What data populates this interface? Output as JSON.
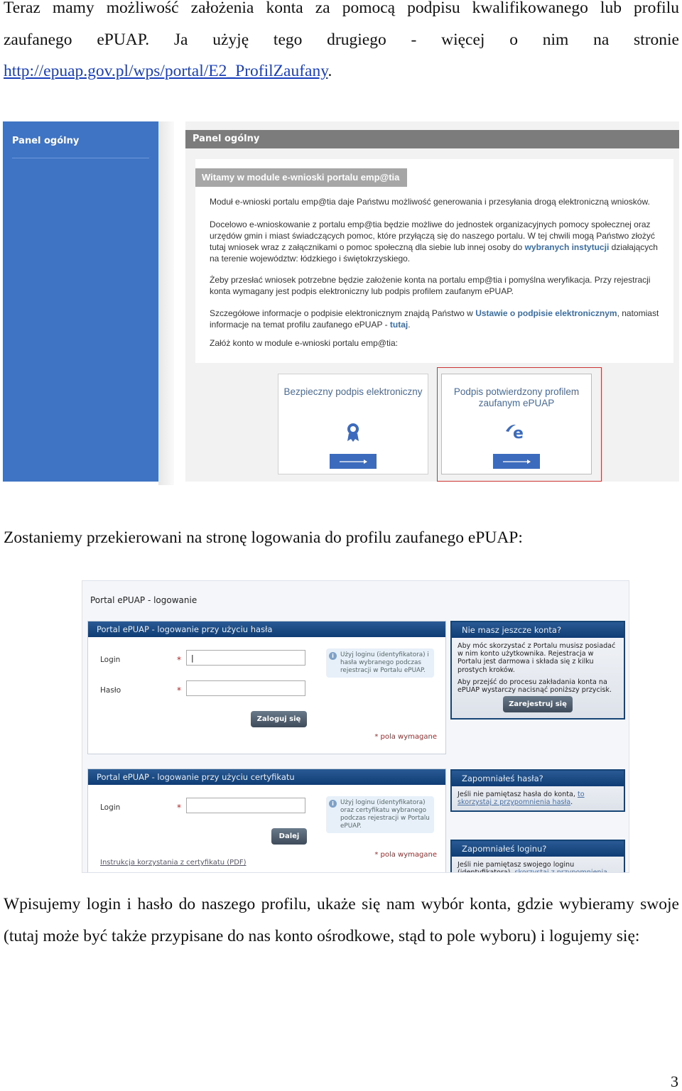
{
  "intro": {
    "line1": "Teraz mamy możliwość założenia konta za pomocą podpisu kwalifikowanego lub profilu",
    "line2": "zaufanego ePUAP. Ja użyję tego drugiego - więcej o nim na stronie",
    "link": "http://epuap.gov.pl/wps/portal/E2_ProfilZaufany",
    "link_suffix": "."
  },
  "empatia": {
    "sidebar_title": "Panel ogólny",
    "header_title": "Panel ogólny",
    "welcome_title": "Witamy w module e-wnioski portalu emp@tia",
    "p1": "Moduł e-wnioski portalu emp@tia daje Państwu możliwość generowania i przesyłania drogą elektroniczną wniosków.",
    "p2_before": "Docelowo e-wnioskowanie z portalu emp@tia będzie możliwe do jednostek organizacyjnych pomocy społecznej oraz urzędów gmin i miast świadczących pomoc, które przyłączą się do naszego portalu. W tej chwili mogą Państwo złożyć tutaj wniosek wraz z załącznikami o pomoc społeczną dla siebie lub innej osoby do ",
    "p2_link": "wybranych instytucji",
    "p2_after": " działających na terenie województw: łódzkiego i świętokrzyskiego.",
    "p3": "Żeby przesłać wniosek potrzebne będzie założenie konta na portalu emp@tia i pomyślna weryfikacja. Przy rejestracji konta wymagany jest podpis elektroniczny lub podpis profilem zaufanym ePUAP.",
    "p4_before": "Szczegółowe informacje o podpisie elektronicznym znajdą Państwo w ",
    "p4_link1": "Ustawie o podpisie elektronicznym",
    "p4_middle": ", natomiast informacje na temat profilu zaufanego ePUAP - ",
    "p4_link2": "tutaj",
    "p4_after": ".",
    "p5": "Załóż konto w module e-wnioski portalu emp@tia:",
    "cards": [
      {
        "title": "Bezpieczny podpis elektroniczny",
        "icon": "ribbon-badge-icon",
        "button_icon": "arrow-right-icon",
        "selected": false
      },
      {
        "title": "Podpis potwierdzony profilem zaufanym ePUAP",
        "icon": "epuap-logo-icon",
        "button_icon": "arrow-right-icon",
        "selected": true
      }
    ]
  },
  "redirect_text": "Zostaniemy przekierowani na stronę logowania do profilu zaufanego ePUAP:",
  "epuap": {
    "page_title": "Portal ePUAP - logowanie",
    "password_panel": {
      "title": "Portal ePUAP - logowanie przy użyciu hasła",
      "login_label": "Login",
      "login_value": "|",
      "password_label": "Hasło",
      "password_value": "",
      "required_mark": "*",
      "info": "Użyj loginu (identyfikatora) i hasła wybranego podczas rejestracji w Portalu ePUAP.",
      "submit": "Zaloguj się",
      "required_note": "* pola wymagane"
    },
    "cert_panel": {
      "title": "Portal ePUAP - logowanie przy użyciu certyfikatu",
      "login_label": "Login",
      "login_value": "",
      "required_mark": "*",
      "info": "Użyj loginu (identyfikatora) oraz certyfikatu wybranego podczas rejestracji w Portalu ePUAP.",
      "submit": "Dalej",
      "required_note": "* pola wymagane",
      "pdf_link": "Instrukcja korzystania z certyfikatu (PDF)"
    },
    "register_box": {
      "title": "Nie masz jeszcze konta?",
      "p1": "Aby móc skorzystać z Portalu musisz posiadać w nim konto użytkownika. Rejestracja w Portalu jest darmowa i składa się z kilku prostych kroków.",
      "p2": "Aby przejść do procesu zakładania konta na ePUAP wystarczy nacisnąć poniższy przycisk.",
      "button": "Zarejestruj się"
    },
    "forgot_password": {
      "title": "Zapomniałeś hasła?",
      "text": "Jeśli nie pamiętasz hasła do konta, ",
      "link": "to skorzystaj z przypomnienia hasła",
      "after": "."
    },
    "forgot_login": {
      "title": "Zapomniałeś loginu?",
      "text": "Jeśli nie pamiętasz swojego loginu (identyfikatora), ",
      "link": "skorzystaj z przypomnienia"
    }
  },
  "outro": {
    "text": "Wpisujemy login i hasło do naszego profilu, ukaże się nam wybór konta, gdzie wybieramy swoje (tutaj może być także przypisane do nas konto ośrodkowe, stąd to pole wyboru) i logujemy się:"
  },
  "page_number": "3",
  "colors": {
    "sidebar_blue": "#3f74c5",
    "epuap_navy": "#0f3c74",
    "link_blue": "#1a3fbd",
    "selected_frame": "#cc3333"
  }
}
